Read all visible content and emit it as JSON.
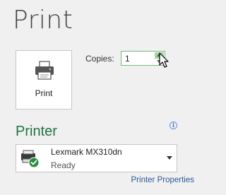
{
  "header": {
    "title": "Print"
  },
  "print_button": {
    "label": "Print",
    "icon": "printer-icon"
  },
  "copies": {
    "label": "Copies:",
    "value": "1"
  },
  "printer_section": {
    "title": "Printer",
    "info_icon": "info-icon",
    "selected_printer": {
      "name": "Lexmark MX310dn",
      "status": "Ready",
      "icon": "printer-ready-icon"
    },
    "properties_link": "Printer Properties"
  },
  "colors": {
    "accent_green": "#217346",
    "link_blue": "#2b579a",
    "background": "#f0f0f0"
  }
}
